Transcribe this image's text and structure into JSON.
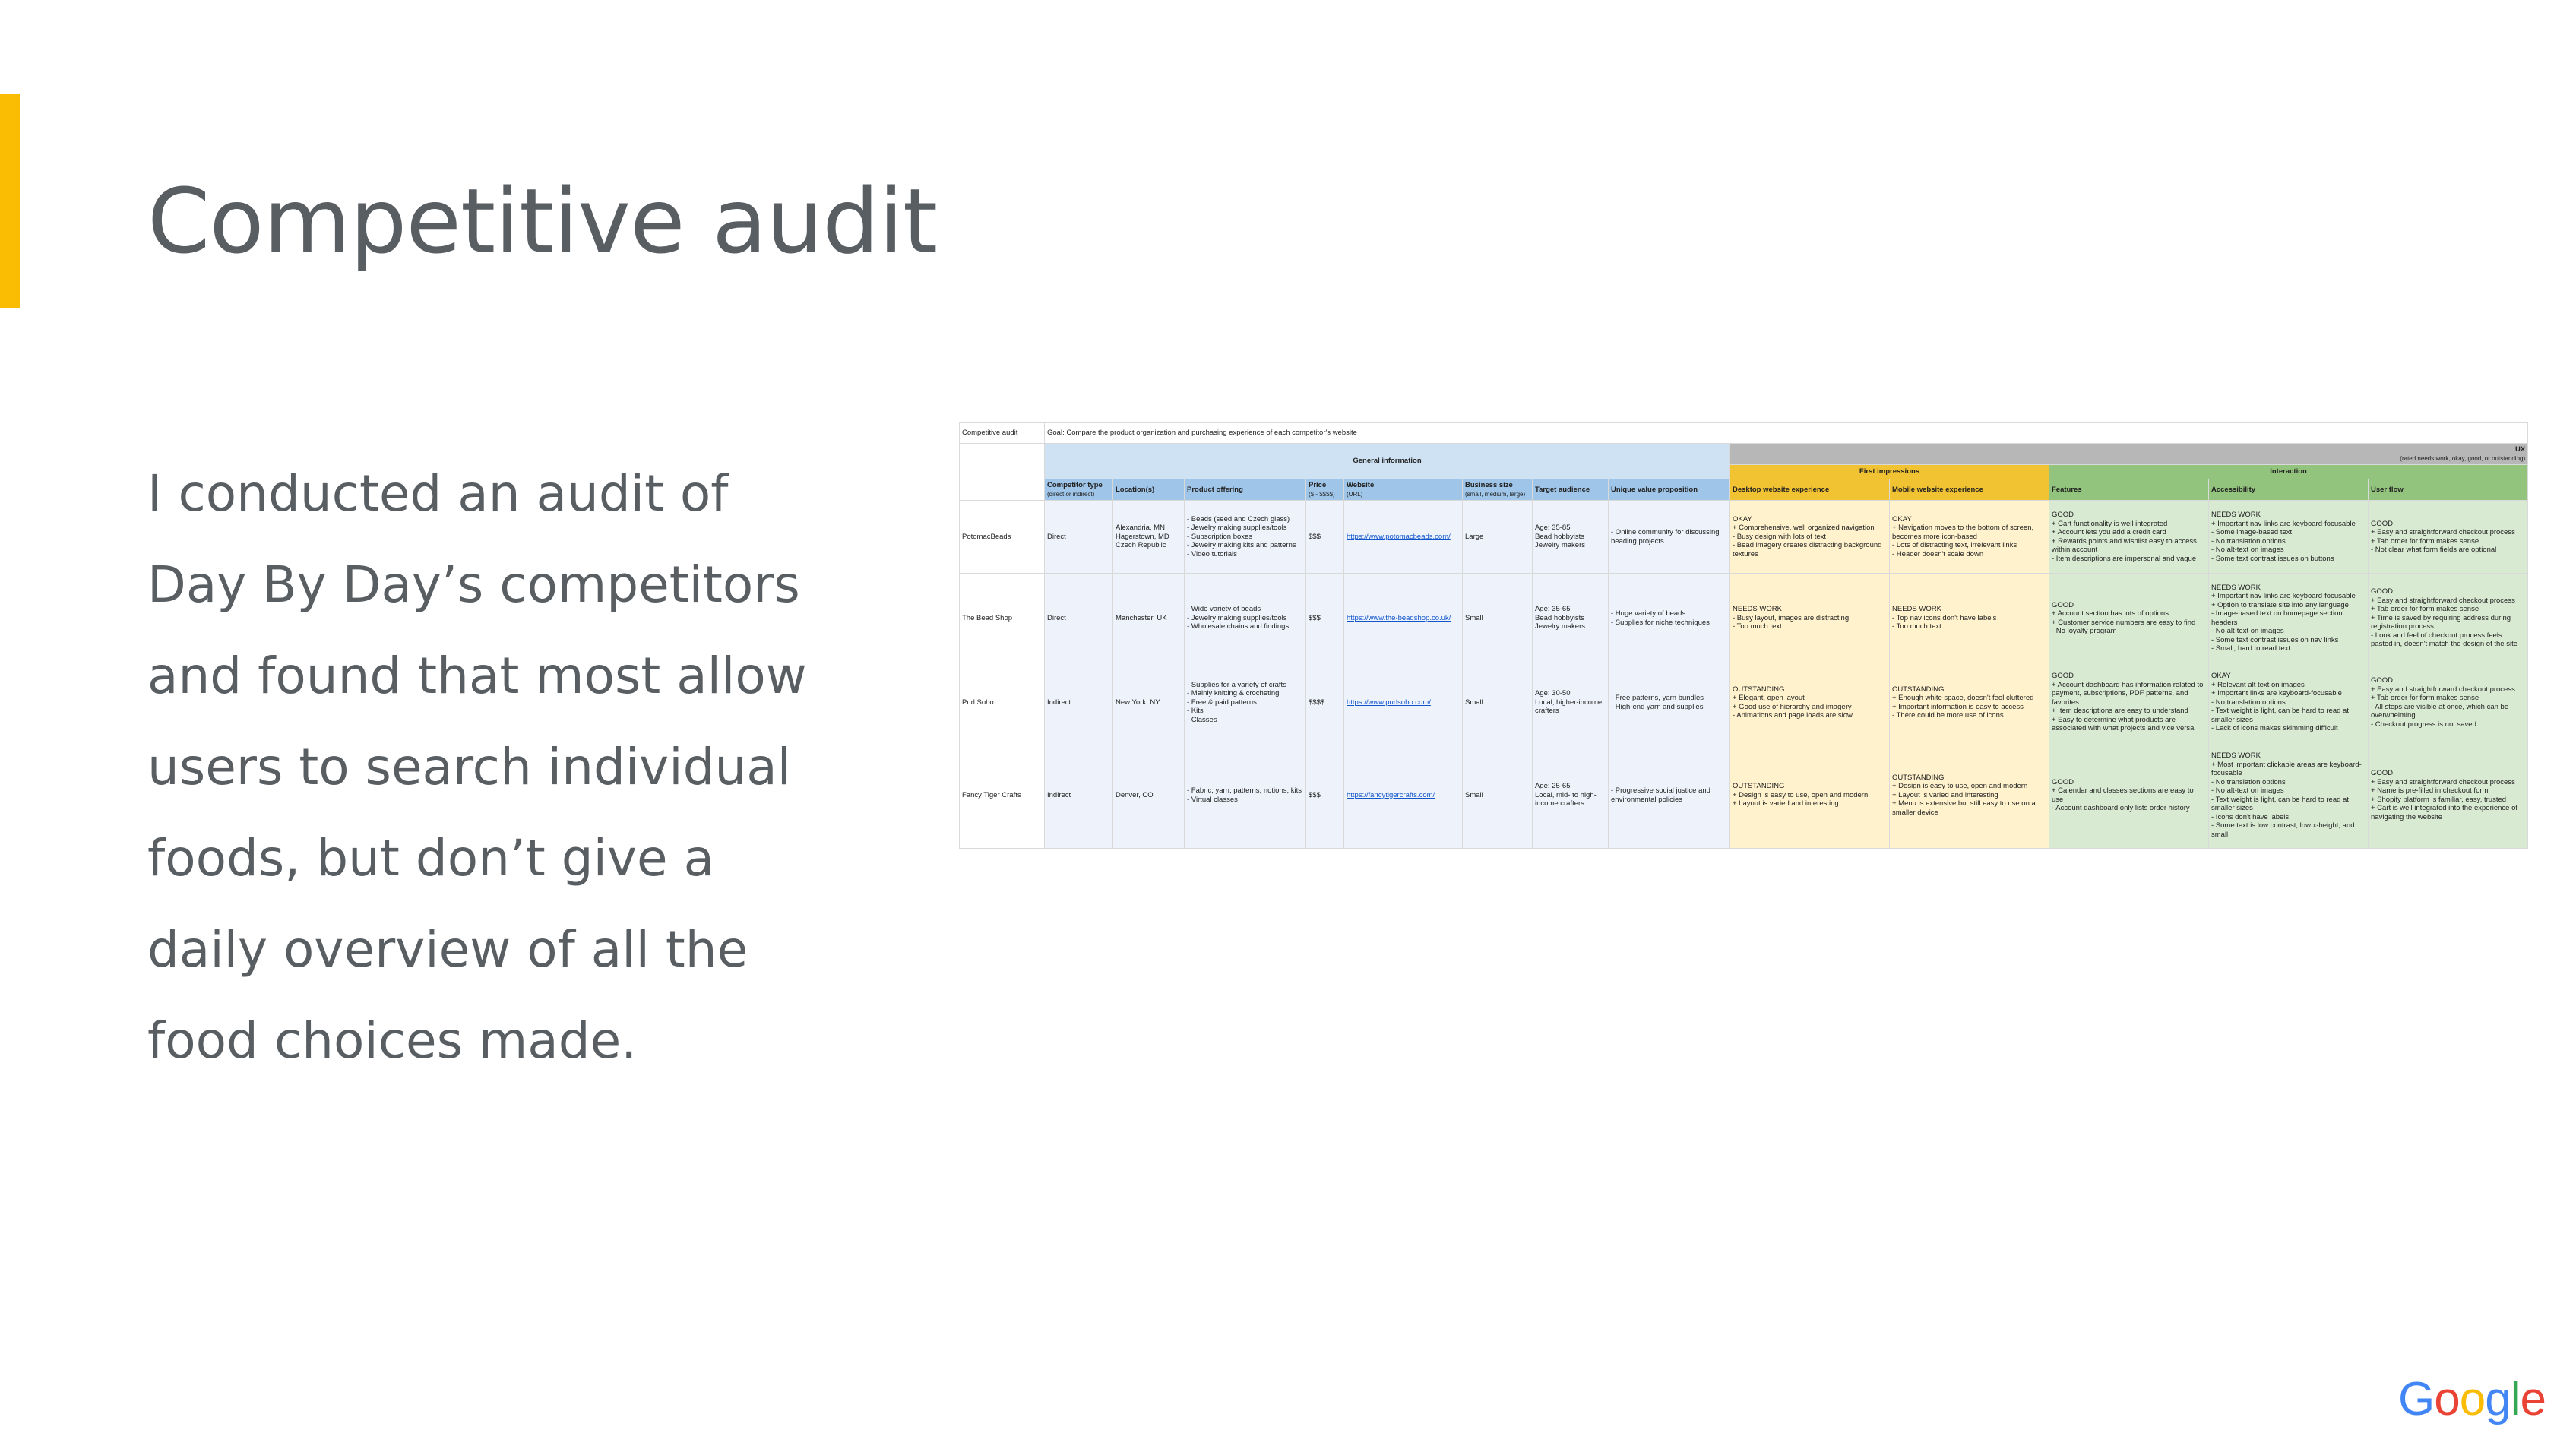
{
  "slide": {
    "title": "Competitive audit",
    "body": "I conducted an audit of Day By Day’s competitors and found that most allow users to search individual foods, but don’t give a daily overview of all the food choices made.",
    "accent_color": "#fbbc04",
    "text_color": "#595e63"
  },
  "sheet": {
    "sheet_title": "Competitive audit",
    "goal": "Goal: Compare the product organization and purchasing experience of each competitor's website",
    "group_general": "General information",
    "group_ux": "UX",
    "group_ux_note": "(rated needs work, okay, good, or outstanding)",
    "group_first_impressions": "First impressions",
    "group_interaction": "Interaction",
    "headers": {
      "competitor_type": "Competitor type",
      "competitor_type_note": "(direct or indirect)",
      "locations": "Location(s)",
      "product_offering": "Product offering",
      "price": "Price",
      "price_note": "($ - $$$$)",
      "website": "Website",
      "website_note": "(URL)",
      "business_size": "Business size",
      "business_size_note": "(small, medium, large)",
      "target_audience": "Target audience",
      "uvp": "Unique value proposition",
      "desktop": "Desktop website experience",
      "mobile": "Mobile website experience",
      "features": "Features",
      "accessibility": "Accessibility",
      "user_flow": "User flow"
    },
    "rows": [
      {
        "name": "PotomacBeads",
        "type": "Direct",
        "location": "Alexandria, MN\nHagerstown, MD\nCzech Republic",
        "offering": "- Beads (seed and Czech glass)\n- Jewelry making supplies/tools\n- Subscription boxes\n- Jewelry making kits and patterns\n- Video tutorials",
        "price": "$$$",
        "website": "https://www.potomacbeads.com/",
        "size": "Large",
        "audience": "Age: 35-85\nBead hobbyists\nJewelry makers",
        "uvp": "- Online community for discussing beading projects",
        "desktop": "OKAY\n+ Comprehensive, well organized navigation\n- Busy design with lots of text\n- Bead imagery creates distracting background textures",
        "mobile": "OKAY\n+ Navigation moves to the bottom of screen, becomes more icon-based\n- Lots of distracting text, irrelevant links\n- Header doesn't scale down",
        "features": "GOOD\n+ Cart functionality is well integrated\n+ Account lets you add a credit card\n+ Rewards points and wishlist easy to access within account\n- Item descriptions are impersonal and vague",
        "accessibility": "NEEDS WORK\n+ Important nav links are keyboard-focusable\n- Some image-based text\n- No translation options\n- No alt-text on images\n- Some text contrast issues on buttons",
        "user_flow": "GOOD\n+ Easy and straightforward checkout process\n+ Tab order for form makes sense\n- Not clear what form fields are optional"
      },
      {
        "name": "The Bead Shop",
        "type": "Direct",
        "location": "Manchester, UK",
        "offering": "- Wide variety of beads\n- Jewelry making supplies/tools\n- Wholesale chains and findings",
        "price": "$$$",
        "website": "https://www.the-beadshop.co.uk/",
        "size": "Small",
        "audience": "Age: 35-65\nBead hobbyists\nJewelry makers",
        "uvp": "- Huge variety of beads\n- Supplies for niche techniques",
        "desktop": "NEEDS WORK\n- Busy layout, images are distracting\n- Too much text",
        "mobile": "NEEDS WORK\n- Top nav icons don't have labels\n- Too much text",
        "features": "GOOD\n+ Account section has lots of options\n+ Customer service numbers are easy to find\n- No loyalty program",
        "accessibility": "NEEDS WORK\n+ Important nav links are keyboard-focusable\n+ Option to translate site into any language\n- Image-based text on homepage section headers\n- No alt-text on images\n- Some text contrast issues on nav links\n- Small, hard to read text",
        "user_flow": "GOOD\n+ Easy and straightforward checkout process\n+ Tab order for form makes sense\n+ Time is saved by requiring address during registration process\n- Look and feel of checkout process feels pasted in, doesn't match the design of the site"
      },
      {
        "name": "Purl Soho",
        "type": "Indirect",
        "location": "New York, NY",
        "offering": "- Supplies for a variety of crafts\n  - Mainly knitting & crocheting\n- Free & paid patterns\n- Kits\n- Classes",
        "price": "$$$$",
        "website": "https://www.purlsoho.com/",
        "size": "Small",
        "audience": "Age: 30-50\nLocal, higher-income crafters",
        "uvp": "- Free patterns, yarn bundles\n- High-end yarn and supplies",
        "desktop": "OUTSTANDING\n+ Elegant, open layout\n+ Good use of hierarchy and imagery\n- Animations and page loads are slow",
        "mobile": "OUTSTANDING\n+ Enough white space, doesn't feel cluttered\n+ Important information is easy to access\n- There could be more use of icons",
        "features": "GOOD\n+ Account dashboard has information related to payment, subscriptions, PDF patterns, and favorites\n+ Item descriptions are easy to understand\n+ Easy to determine what products are associated with what projects and vice versa",
        "accessibility": "OKAY\n+ Relevant alt text on images\n+ Important links are keyboard-focusable\n- No translation options\n- Text weight is light, can be hard to read at smaller sizes\n- Lack of icons makes skimming difficult",
        "user_flow": "GOOD\n+ Easy and straightforward checkout process\n+ Tab order for form makes sense\n- All steps are visible at once, which can be overwhelming\n- Checkout progress is not saved"
      },
      {
        "name": "Fancy Tiger Crafts",
        "type": "Indirect",
        "location": "Denver, CO",
        "offering": "- Fabric, yarn, patterns, notions, kits\n- Virtual classes",
        "price": "$$$",
        "website": "https://fancytigercrafts.com/",
        "size": "Small",
        "audience": "Age: 25-65\nLocal, mid- to high-income crafters",
        "uvp": "- Progressive social justice and environmental policies",
        "desktop": "OUTSTANDING\n+ Design is easy to use, open and modern\n+ Layout is varied and interesting",
        "mobile": "OUTSTANDING\n+ Design is easy to use, open and modern\n+ Layout is varied and interesting\n+ Menu is extensive but still easy to use on a smaller device",
        "features": "GOOD\n+ Calendar and classes sections are easy to use\n- Account dashboard only lists order history",
        "accessibility": "NEEDS WORK\n+ Most important clickable areas are keyboard-focusable\n- No translation options\n- No alt-text on images\n- Text weight is light, can be hard to read at smaller sizes\n- Icons don't have labels\n- Some text is low contrast, low x-height, and small",
        "user_flow": "GOOD\n+ Easy and straightforward checkout process\n+ Name is pre-filled in checkout form\n+ Shopify platform is familiar, easy, trusted\n+ Cart is well integrated into the experience of navigating the website"
      }
    ]
  },
  "logo": {
    "letters": [
      "G",
      "o",
      "o",
      "g",
      "l",
      "e"
    ],
    "colors": [
      "#4285f4",
      "#ea4335",
      "#fbbc05",
      "#4285f4",
      "#34a853",
      "#ea4335"
    ]
  }
}
